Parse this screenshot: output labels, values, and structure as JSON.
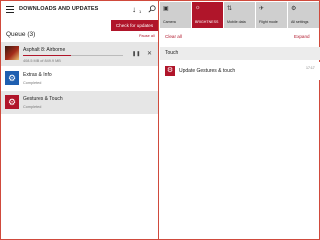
{
  "header": {
    "title": "DOWNLOADS AND UPDATES",
    "download_count": "1",
    "tooltip": "Check for updates"
  },
  "queue": {
    "label": "Queue (3)",
    "action": "Pause all",
    "items": [
      {
        "name": "Asphalt 8: Airborne",
        "status": "408.5 MB of 849.9 MB",
        "progress": 0.48,
        "icon": "game-thumbnail"
      },
      {
        "name": "Extras & Info",
        "status": "Completed",
        "icon": "gear-icon"
      },
      {
        "name": "Gestures & Touch",
        "status": "Completed",
        "icon": "gear-icon"
      }
    ]
  },
  "action_center": {
    "tiles": [
      {
        "label": "Camera",
        "icon": "camera-icon"
      },
      {
        "label": "BRIGHTNESS",
        "icon": "brightness-icon"
      },
      {
        "label": "Mobile data",
        "icon": "mobile-data-icon"
      },
      {
        "label": "Flight mode",
        "icon": "airplane-icon"
      },
      {
        "label": "All settings",
        "icon": "settings-icon"
      }
    ],
    "clear_all": "Clear all",
    "expand": "Expand",
    "section": "Touch",
    "notification": {
      "text": "Update Gestures & touch",
      "time": "17:17",
      "icon": "gear-icon"
    }
  },
  "colors": {
    "accent": "#b0152a",
    "row_highlight": "#e6e6e6",
    "tile": "#cfcfcf"
  }
}
